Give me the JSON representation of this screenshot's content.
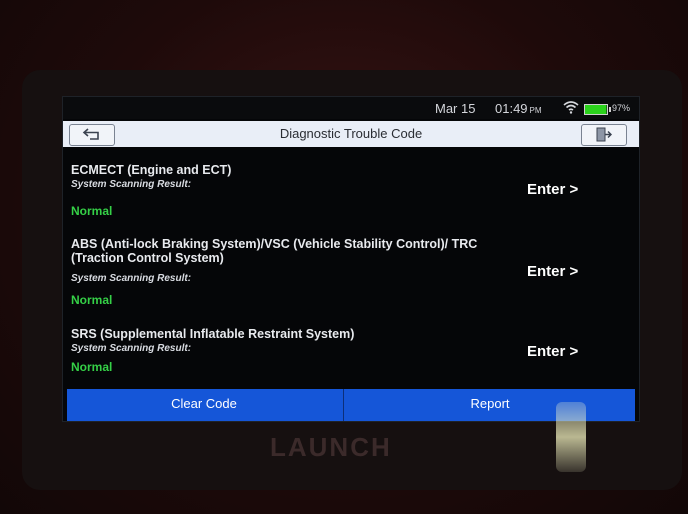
{
  "status_bar": {
    "date": "Mar 15",
    "time": "01:49",
    "ampm": "PM",
    "battery_pct": "97%",
    "battery_level": 0.97
  },
  "header": {
    "title": "Diagnostic Trouble Code"
  },
  "systems": [
    {
      "name": "ECMECT (Engine and ECT)",
      "scan_label": "System Scanning Result:",
      "result": "Normal",
      "enter_label": "Enter >"
    },
    {
      "name": "ABS (Anti-lock Braking System)/VSC (Vehicle Stability Control)/ TRC (Traction Control System)",
      "scan_label": "System Scanning Result:",
      "result": "Normal",
      "enter_label": "Enter >"
    },
    {
      "name": "SRS (Supplemental Inflatable Restraint System)",
      "scan_label": "System Scanning Result:",
      "result": "Normal",
      "enter_label": "Enter >"
    }
  ],
  "footer": {
    "clear_code_label": "Clear Code",
    "report_label": "Report"
  },
  "device": {
    "brand": "LAUNCH"
  },
  "colors": {
    "accent": "#1556d8",
    "normal_status": "#35d047",
    "title_bar": "#e9eef7"
  }
}
